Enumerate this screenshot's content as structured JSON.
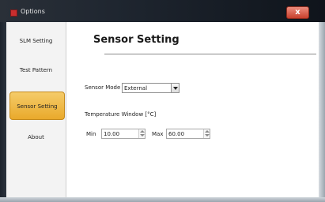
{
  "window": {
    "title": "Options",
    "close_glyph": "x"
  },
  "sidebar": {
    "items": [
      {
        "label": "SLM Setting",
        "active": false
      },
      {
        "label": "Test Pattern",
        "active": false
      },
      {
        "label": "Sensor Setting",
        "active": true
      },
      {
        "label": "About",
        "active": false
      }
    ]
  },
  "main": {
    "heading": "Sensor Setting",
    "sensor_mode": {
      "label": "Sensor Mode",
      "value": "External"
    },
    "temperature": {
      "label": "Temperature Window [°C]",
      "min_label": "Min",
      "min_value": "10.00",
      "max_label": "Max",
      "max_value": "60.00"
    }
  },
  "colors": {
    "active_tab": "#e9a92b",
    "title_bar": "#1f2630",
    "close_button": "#c8402d"
  }
}
